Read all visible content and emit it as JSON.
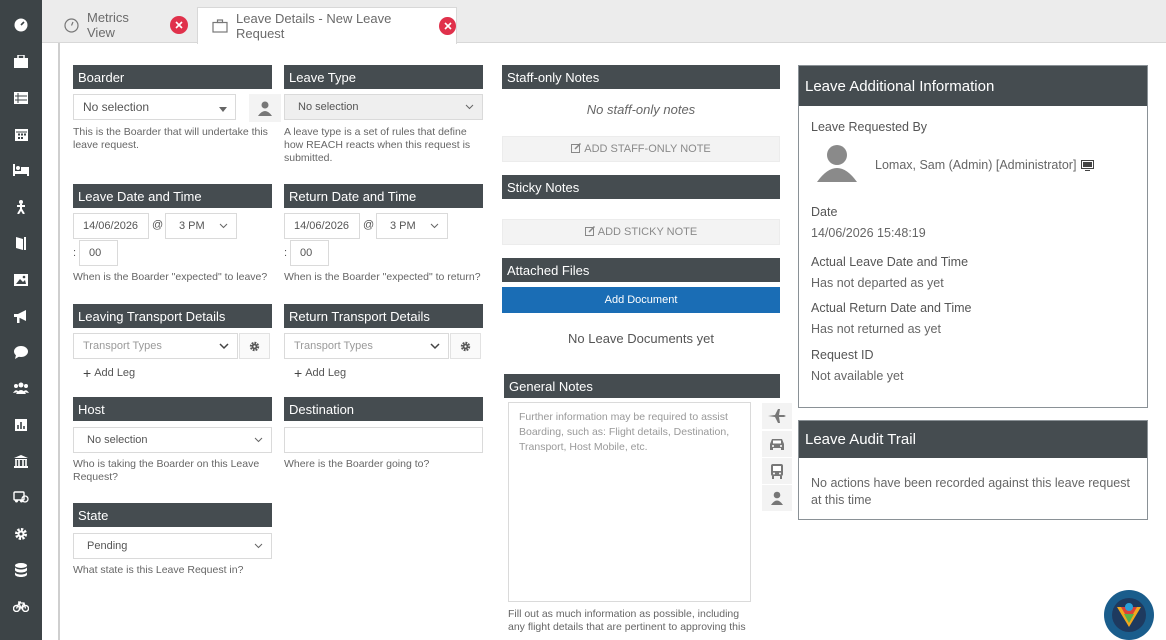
{
  "sidebar_icons": [
    "dashboard-icon",
    "briefcase-icon",
    "table-icon",
    "calendar-icon",
    "bed-icon",
    "person-walking-icon",
    "door-icon",
    "image-icon",
    "megaphone-icon",
    "chat-icon",
    "users-icon",
    "chart-icon",
    "bank-icon",
    "transport-icon",
    "gear-icon",
    "database-icon",
    "bicycle-icon"
  ],
  "tabs": [
    {
      "label": "Metrics View"
    },
    {
      "label": "Leave Details - New Leave Request"
    }
  ],
  "boarder": {
    "title": "Boarder",
    "value": "No selection",
    "help": "This is the Boarder that will undertake this leave request."
  },
  "leave_type": {
    "title": "Leave Type",
    "value": "No selection",
    "help": "A leave type is a set of rules that define how REACH reacts when this request is submitted."
  },
  "leave_date": {
    "title": "Leave Date and Time",
    "date": "14/06/2026",
    "at": "@",
    "hour": "3 PM",
    "colon": ":",
    "minute": "00",
    "help": "When is the Boarder \"expected\" to leave?"
  },
  "return_date": {
    "title": "Return Date and Time",
    "date": "14/06/2026",
    "at": "@",
    "hour": "3 PM",
    "colon": ":",
    "minute": "00",
    "help": "When is the Boarder \"expected\" to return?"
  },
  "leaving_transport": {
    "title": "Leaving Transport Details",
    "placeholder": "Transport Types",
    "add_leg": "Add Leg"
  },
  "return_transport": {
    "title": "Return Transport Details",
    "placeholder": "Transport Types",
    "add_leg": "Add Leg"
  },
  "host": {
    "title": "Host",
    "value": "No selection",
    "help": "Who is taking the Boarder on this Leave Request?"
  },
  "destination": {
    "title": "Destination",
    "value": "",
    "help": "Where is the Boarder going to?"
  },
  "state": {
    "title": "State",
    "value": "Pending",
    "help": "What state is this Leave Request in?"
  },
  "staff_notes": {
    "title": "Staff-only Notes",
    "empty": "No staff-only notes",
    "button": "ADD STAFF-ONLY NOTE"
  },
  "sticky_notes": {
    "title": "Sticky Notes",
    "button": "ADD STICKY NOTE"
  },
  "attached_files": {
    "title": "Attached Files",
    "button": "Add Document",
    "empty": "No Leave Documents yet"
  },
  "general_notes": {
    "title": "General Notes",
    "placeholder": "Further information may be required to assist Boarding, such as: Flight details, Destination, Transport, Host Mobile, etc.",
    "help": "Fill out as much information as possible, including any flight details that are pertinent to approving this"
  },
  "info": {
    "title": "Leave Additional Information",
    "requested_by_label": "Leave Requested By",
    "requested_by": "Lomax, Sam (Admin) [Administrator]",
    "date_label": "Date",
    "date": "14/06/2026 15:48:19",
    "actual_leave_label": "Actual Leave Date and Time",
    "actual_leave": "Has not departed as yet",
    "actual_return_label": "Actual Return Date and Time",
    "actual_return": "Has not returned as yet",
    "request_id_label": "Request ID",
    "request_id": "Not available yet"
  },
  "audit": {
    "title": "Leave Audit Trail",
    "text": "No actions have been recorded against this leave request at this time"
  },
  "colors": {
    "header": "#454c50",
    "primary": "#1a6db5",
    "close": "#e0314b",
    "sidebar": "#3d4447"
  }
}
